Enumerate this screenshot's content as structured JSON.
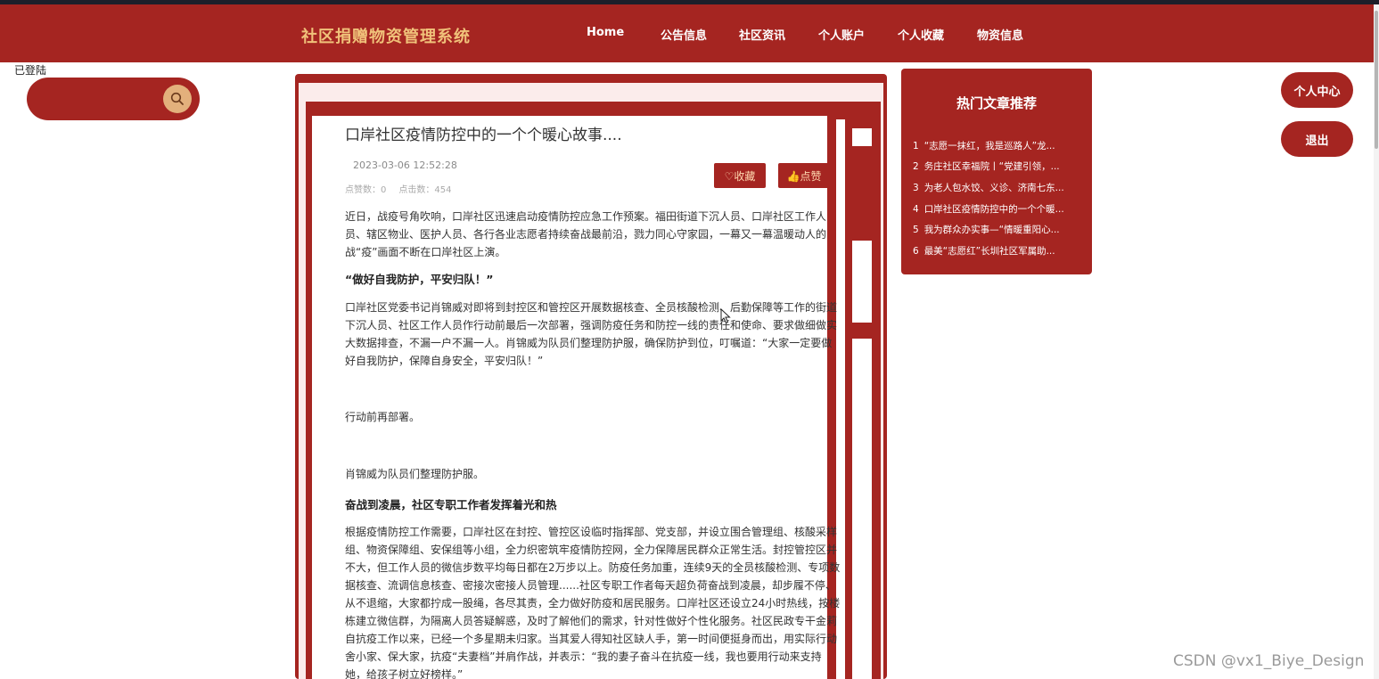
{
  "brand": "社区捐赠物资管理系统",
  "nav": [
    "Home",
    "公告信息",
    "社区资讯",
    "个人账户",
    "个人收藏",
    "物资信息"
  ],
  "mini_label": "已登陆",
  "search": {
    "value": "",
    "placeholder": "",
    "icon": "search-icon"
  },
  "article": {
    "title": "口岸社区疫情防控中的一个个暖心故事....",
    "date": "2023-03-06 12:52:28",
    "likes_label": "点赞数：0",
    "clicks_label": "点击数：454",
    "favorite_button": "♡收藏",
    "like_button": "👍点赞",
    "p1": "近日，战疫号角吹响，口岸社区迅速启动疫情防控应急工作预案。福田街道下沉人员、口岸社区工作人员、辖区物业、医护人员、各行各业志愿者持续奋战最前沿，戮力同心守家园，一幕又一幕温暖动人的战“疫”画面不断在口岸社区上演。",
    "h1": "“做好自我防护，平安归队！”",
    "p2": "口岸社区党委书记肖锦威对即将到封控区和管控区开展数据核查、全员核酸检测、后勤保障等工作的街道下沉人员、社区工作人员作行动前最后一次部署，强调防疫任务和防控一线的责任和使命、要求做细做实大数据排查，不漏一户不漏一人。肖锦威为队员们整理防护服，确保防护到位，叮嘱道：“大家一定要做好自我防护，保障自身安全，平安归队！”",
    "p3": "行动前再部署。",
    "p4": "肖锦威为队员们整理防护服。",
    "h2": "奋战到凌晨，社区专职工作者发挥着光和热",
    "p5": "根据疫情防控工作需要，口岸社区在封控、管控区设临时指挥部、党支部，并设立围合管理组、核酸采样组、物资保障组、安保组等小组，全力织密筑牢疫情防控网，全力保障居民群众正常生活。封控管控区并不大，但工作人员的微信步数平均每日都在2万步以上。防疫任务加重，连续9天的全员核酸检测、专项数据核查、流调信息核查、密接次密接人员管理......社区专职工作者每天超负荷奋战到凌晨，却步履不停、从不退缩，大家都拧成一股绳，各尽其责，全力做好防疫和居民服务。口岸社区还设立24小时热线，按楼栋建立微信群，为隔离人员答疑解惑，及时了解他们的需求，针对性做好个性化服务。社区民政专干金莉自抗疫工作以来，已经一个多星期未归家。当其爱人得知社区缺人手，第一时间便挺身而出，用实际行动舍小家、保大家，抗疫“夫妻档”并肩作战，并表示：“我的妻子奋斗在抗疫一线，我也要用行动来支持她，给孩子树立好榜样。”"
  },
  "hot": {
    "title": "热门文章推荐",
    "items": [
      {
        "num": "1",
        "text": "“志愿一抹红，我是巡路人”龙..."
      },
      {
        "num": "2",
        "text": "务庄社区幸福院丨“党建引领，..."
      },
      {
        "num": "3",
        "text": "为老人包水饺、义诊、济南七东..."
      },
      {
        "num": "4",
        "text": "口岸社区疫情防控中的一个个暖..."
      },
      {
        "num": "5",
        "text": "我为群众办实事—“情暖重阳心..."
      },
      {
        "num": "6",
        "text": "最美“志愿红”长圳社区军属助..."
      }
    ]
  },
  "personal_center": "个人中心",
  "logout": "退出",
  "watermark": "CSDN @vx1_Biye_Design",
  "colors": {
    "primary": "#a52521",
    "brand_text": "#f0c27a",
    "search_button": "#e3b07c"
  }
}
